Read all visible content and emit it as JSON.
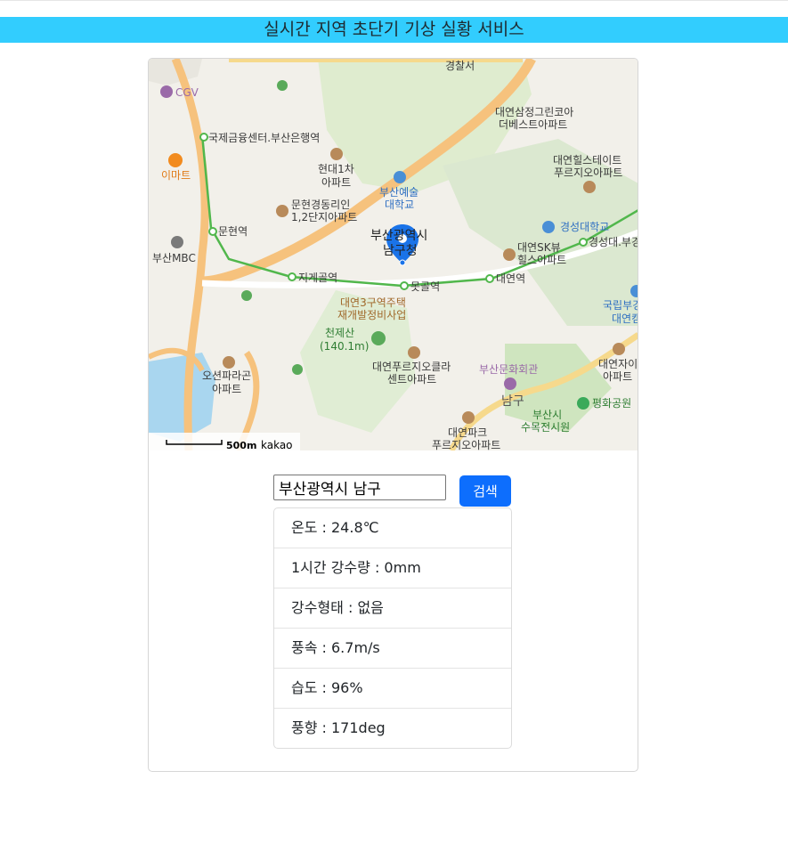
{
  "header": {
    "title": "실시간 지역 초단기 기상 실황 서비스"
  },
  "map": {
    "labels": {
      "police": "경찰서",
      "cgv": "CGV",
      "ifc": "국제금융센터.부산은행역",
      "emart": "이마트",
      "hyundai": "현대1차",
      "hyundai2": "아파트",
      "arts_univ": "부산예술",
      "arts_univ2": "대학교",
      "munhyeon_apt": "문현경동리인",
      "munhyeon_apt2": "1,2단지아파트",
      "munhyeon_st": "문현역",
      "busan_mbc": "부산MBC",
      "city_hall": "부산광역시",
      "city_hall2": "남구청",
      "jigegol": "지게골역",
      "motgol": "못골역",
      "daeyeon_st": "대연역",
      "redevelop": "대연3구역주택",
      "redevelop2": "재개발정비사업",
      "cheonjesan": "천제산",
      "cheonjesan2": "(140.1m)",
      "prugio": "대연푸르지오클라",
      "prugio2": "센트아파트",
      "oseon": "오션파라곤",
      "oseon2": "아파트",
      "samjeong": "대연삼정그린코아",
      "samjeong2": "더베스트아파트",
      "hillstate": "대연힐스테이트",
      "hillstate2": "푸르지오아파트",
      "kyungsung": "경성대학교",
      "kyungsung_st": "경성대.부경",
      "sk_view": "대연SK뷰",
      "sk_view2": "힐스아파트",
      "national": "국립부경",
      "national2": "대연캠",
      "culture": "부산문화회관",
      "namgu": "남구",
      "arboretum": "부산시",
      "arboretum2": "수목전시원",
      "peace_park": "평화공원",
      "daeyeon_park": "대연파크",
      "daeyeon_park2": "푸르지오아파트",
      "daeyeon_ja": "대연자이",
      "daeyeon_ja2": "아파트",
      "scale": "500m",
      "logo": "kakao"
    }
  },
  "search": {
    "value": "부산광역시 남구",
    "button_label": "검색"
  },
  "weather": [
    {
      "text": "온도 : 24.8℃"
    },
    {
      "text": "1시간 강수량 : 0mm"
    },
    {
      "text": "강수형태 : 없음"
    },
    {
      "text": "풍속 : 6.7m/s"
    },
    {
      "text": "습도 : 96%"
    },
    {
      "text": "풍향 : 171deg"
    }
  ],
  "colors": {
    "header_bg": "#32cdfe",
    "button_bg": "#0d6efd",
    "marker": "#1a73e8",
    "subway": "#51b74c"
  }
}
